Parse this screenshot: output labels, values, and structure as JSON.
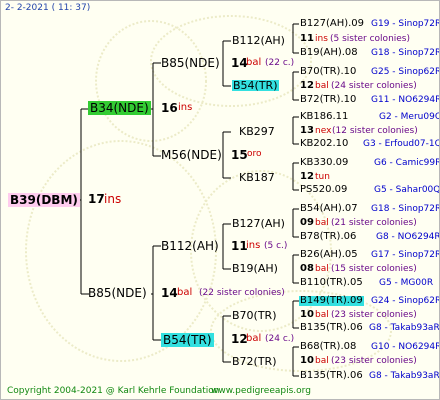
{
  "header": {
    "date": "2-  2-2021 ( 11: 37)"
  },
  "footer": {
    "copyright": "Copyright 2004-2021 @ Karl Kehrle Foundation",
    "website": "www.pedigreeapis.org"
  },
  "colors": {
    "highlight_green": "#33cc33",
    "highlight_cyan": "#33e0e0",
    "highlight_pink": "#ffccee",
    "line": "#000000"
  },
  "root": {
    "id": "B39(DBM)",
    "num": "17",
    "tag": "ins"
  },
  "gen1": {
    "top": {
      "id": "B34(NDE)",
      "num": "16",
      "tag": "ins"
    },
    "bottom": {
      "id": "B85(NDE)",
      "num": "14",
      "tag": "bal",
      "note": "(22 sister colonies)"
    }
  },
  "gen2": {
    "a": {
      "id": "B85(NDE)",
      "num": "14",
      "tag": "bal",
      "note": "(22 c.)"
    },
    "b": {
      "id": "M56(NDE)",
      "num": "15",
      "tag": "oro"
    },
    "c": {
      "id": "B112(AH)",
      "num": "11",
      "tag": "ins",
      "note": "(5 c.)"
    },
    "d": {
      "id": "B54(TR)",
      "num": "12",
      "tag": "bal",
      "note": "(24 c.)"
    }
  },
  "gen3": {
    "a1": "B112(AH)",
    "a2": "B54(TR)",
    "b1": "KB297",
    "b2": "KB187",
    "c1": "B127(AH)",
    "c2": "B19(AH)",
    "d1": "B70(TR)",
    "d2": "B72(TR)"
  },
  "gen4": {
    "g1": {
      "top": "B127(AH).09",
      "top_code": "G19 - Sinop72R",
      "num": "11",
      "tag": "ins",
      "note": "(5 sister colonies)",
      "bottom": "B19(AH).08",
      "bottom_code": "G18 - Sinop72R"
    },
    "g2": {
      "top": "B70(TR).10",
      "top_code": "G25 - Sinop62R",
      "num": "12",
      "tag": "bal",
      "note": "(24 sister colonies)",
      "bottom": "B72(TR).10",
      "bottom_code": "G11 - NO6294R"
    },
    "g3": {
      "top": "KB186.11",
      "top_code": "G2 - Meru09Q",
      "num": "13",
      "tag": "nex",
      "note": "(12 sister colonies)",
      "bottom": "KB202.10",
      "bottom_code": "G3 - Erfoud07-1Q"
    },
    "g4": {
      "top": "KB330.09",
      "top_code": "G6 - Camic99R",
      "num": "12",
      "tag": "tun",
      "note": "",
      "bottom": "PS520.09",
      "bottom_code": "G5 - Sahar00Q"
    },
    "g5": {
      "top": "B54(AH).07",
      "top_code": "G18 - Sinop72R",
      "num": "09",
      "tag": "bal",
      "note": "(21 sister colonies)",
      "bottom": "B78(TR).06",
      "bottom_code": "G8 - NO6294R"
    },
    "g6": {
      "top": "B26(AH).05",
      "top_code": "G17 - Sinop72R",
      "num": "08",
      "tag": "bal",
      "note": "(15 sister colonies)",
      "bottom": "B110(TR).05",
      "bottom_code": "G5 - MG00R"
    },
    "g7": {
      "top": "B149(TR).09",
      "top_code": "G24 - Sinop62R",
      "num": "10",
      "tag": "bal",
      "note": "(23 sister colonies)",
      "bottom": "B135(TR).06",
      "bottom_code": "G8 - Takab93aR"
    },
    "g8": {
      "top": "B68(TR).08",
      "top_code": "G10 - NO6294R",
      "num": "10",
      "tag": "bal",
      "note": "(23 sister colonies)",
      "bottom": "B135(TR).06",
      "bottom_code": "G8 - Takab93aR"
    }
  }
}
